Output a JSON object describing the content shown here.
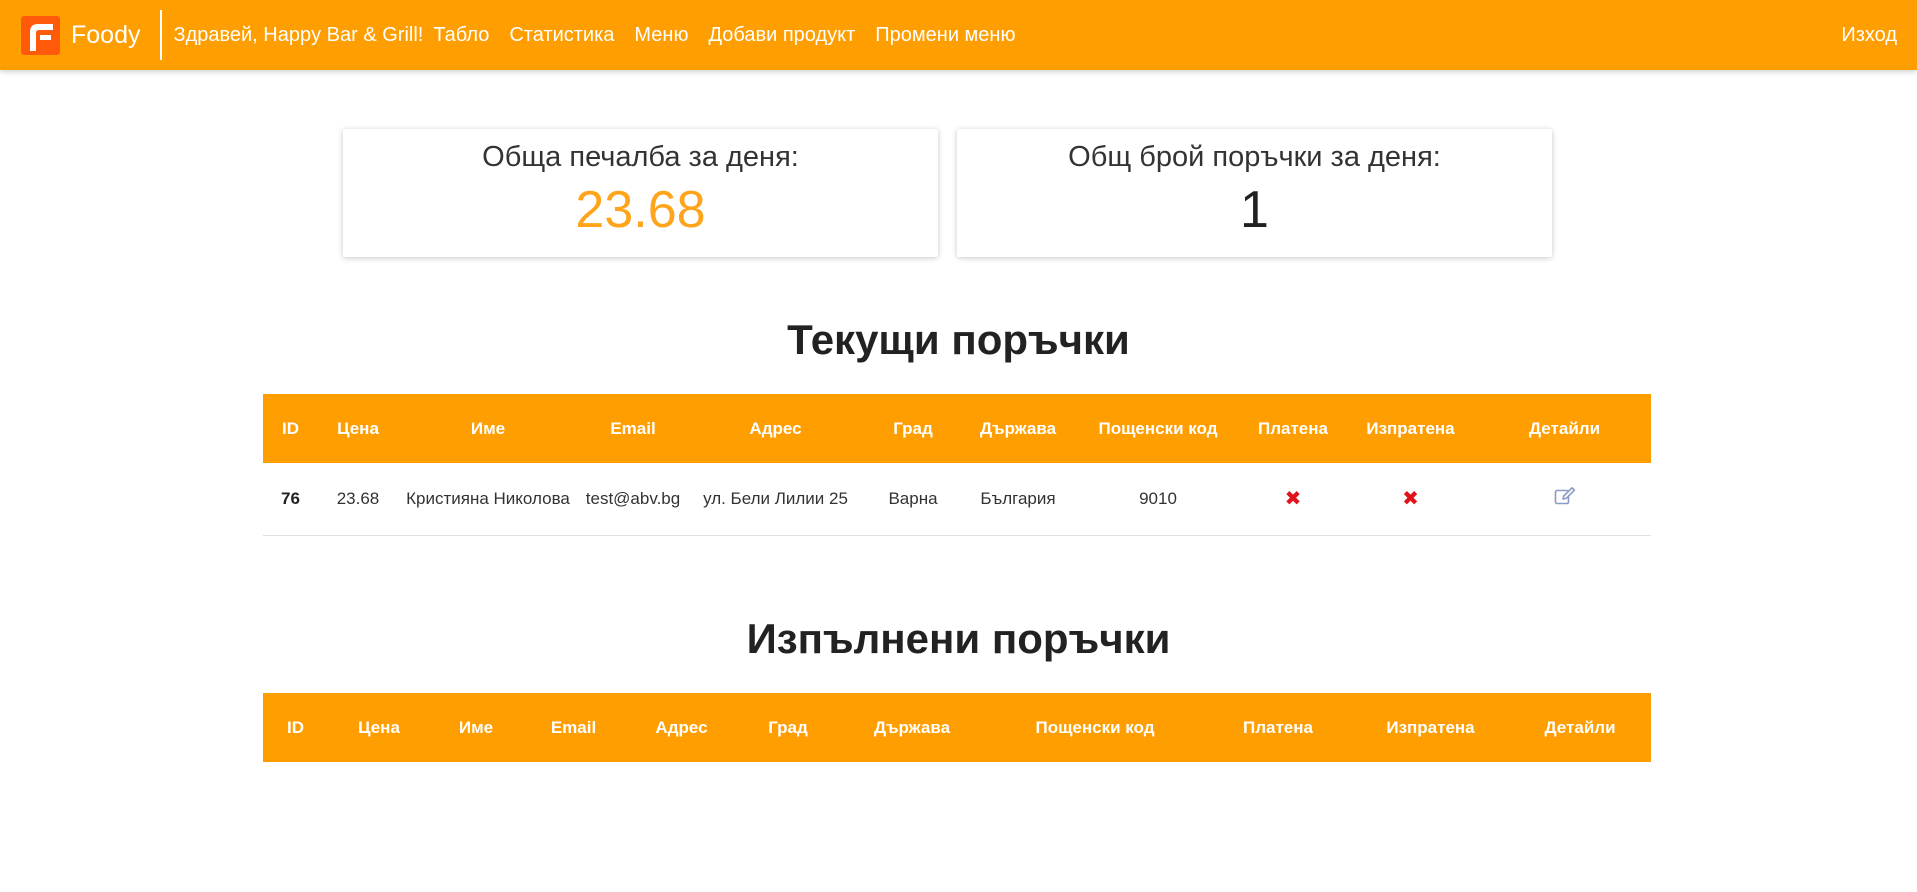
{
  "app": {
    "brand": "Foody",
    "greeting": "Здравей, Happy Bar & Grill!",
    "nav": [
      "Табло",
      "Статистика",
      "Меню",
      "Добави продукт",
      "Промени меню"
    ],
    "logout": "Изход"
  },
  "stats": {
    "profit_label": "Обща печалба за деня:",
    "profit_value": "23.68",
    "orders_label": "Общ брой поръчки за деня:",
    "orders_value": "1"
  },
  "current_orders": {
    "title": "Текущи поръчки",
    "columns": [
      "ID",
      "Цена",
      "Име",
      "Email",
      "Адрес",
      "Град",
      "Държава",
      "Пощенски код",
      "Платена",
      "Изпратена",
      "Детайли"
    ],
    "rows": [
      {
        "id": "76",
        "price": "23.68",
        "name": "Кристияна Николова",
        "email": "test@abv.bg",
        "address": "ул. Бели Лилии 25",
        "city": "Варна",
        "country": "България",
        "postal": "9010",
        "paid": "✖",
        "shipped": "✖"
      }
    ]
  },
  "completed_orders": {
    "title": "Изпълнени поръчки",
    "columns": [
      "ID",
      "Цена",
      "Име",
      "Email",
      "Адрес",
      "Град",
      "Държава",
      "Пощенски код",
      "Платена",
      "Изпратена",
      "Детайли"
    ]
  },
  "colors": {
    "accent": "#ff9e01",
    "logo": "#ff5a0a",
    "profit": "#ffa41b",
    "status_false": "#e0121a"
  },
  "icons": {
    "brand": "foody-logo-icon",
    "paid": "x-icon",
    "shipped": "x-icon",
    "details": "edit-icon"
  }
}
